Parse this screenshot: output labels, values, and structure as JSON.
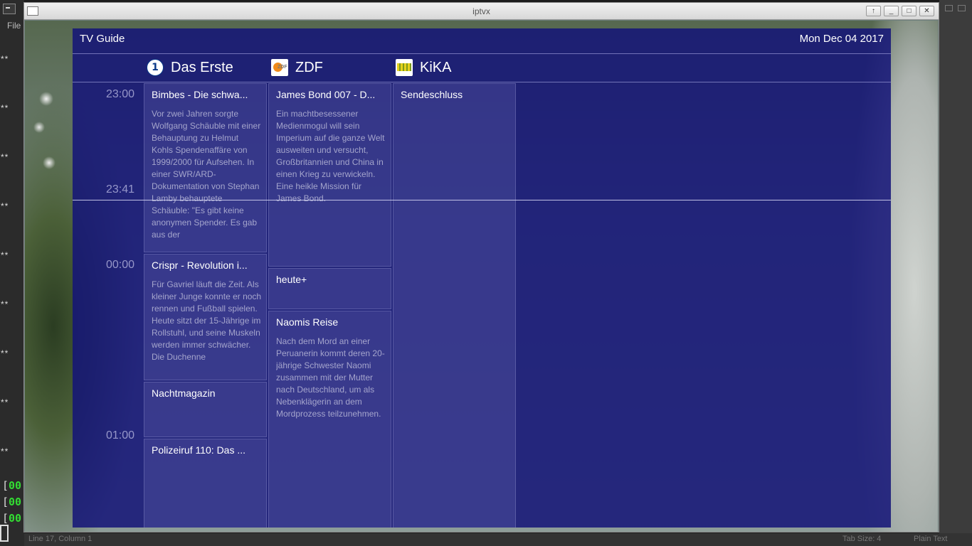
{
  "background": {
    "menu_file": "File",
    "star_rows": [
      "**",
      "**",
      "**",
      "**",
      "**",
      "**",
      "**",
      "**",
      "**"
    ],
    "bracket_rows": [
      "00",
      "00",
      "00"
    ],
    "status_line": "Line 17, Column 1",
    "tab_size": "Tab Size: 4",
    "syntax": "Plain Text"
  },
  "window": {
    "title": "iptvx",
    "buttons": {
      "up": "↑",
      "minimize": "_",
      "maximize": "□",
      "close": "✕"
    }
  },
  "guide": {
    "title": "TV Guide",
    "date": "Mon Dec 04 2017",
    "times": [
      "23:00",
      "23:41",
      "00:00",
      "01:00"
    ],
    "channels": [
      {
        "name": "Das Erste",
        "logo": "ard-logo-icon",
        "programs": [
          {
            "title": "Bimbes - Die schwa...",
            "desc": "Vor zwei Jahren sorgte Wolfgang Schäuble mit einer Behauptung zu Helmut Kohls Spendenaffäre von 1999/2000 für Aufsehen. In einer SWR/ARD-Dokumentation von Stephan Lamby behauptete Schäuble: \"Es gibt keine anonymen Spender. Es gab aus der"
          },
          {
            "title": "Crispr - Revolution i...",
            "desc": "Für Gavriel läuft die Zeit. Als kleiner Junge konnte er noch rennen und Fußball spielen. Heute sitzt der 15-Jährige im Rollstuhl, und seine Muskeln werden immer schwächer. Die Duchenne"
          },
          {
            "title": "Nachtmagazin",
            "desc": ""
          },
          {
            "title": "Polizeiruf 110: Das ...",
            "desc": ""
          }
        ]
      },
      {
        "name": "ZDF",
        "logo": "zdf-logo-icon",
        "programs": [
          {
            "title": "James Bond 007 - D...",
            "desc": "Ein machtbesessener Medienmogul will sein Imperium auf die ganze Welt ausweiten und versucht, Großbritannien und China in einen Krieg zu verwickeln. Eine heikle Mission für James Bond."
          },
          {
            "title": "heute+",
            "desc": ""
          },
          {
            "title": "Naomis Reise",
            "desc": "Nach dem Mord an einer Peruanerin kommt deren 20-jährige Schwester Naomi zusammen mit der Mutter nach Deutschland, um als Nebenklägerin an dem Mordprozess teilzunehmen."
          }
        ]
      },
      {
        "name": "KiKA",
        "logo": "kika-logo-icon",
        "programs": [
          {
            "title": "Sendeschluss",
            "desc": ""
          }
        ]
      }
    ]
  }
}
